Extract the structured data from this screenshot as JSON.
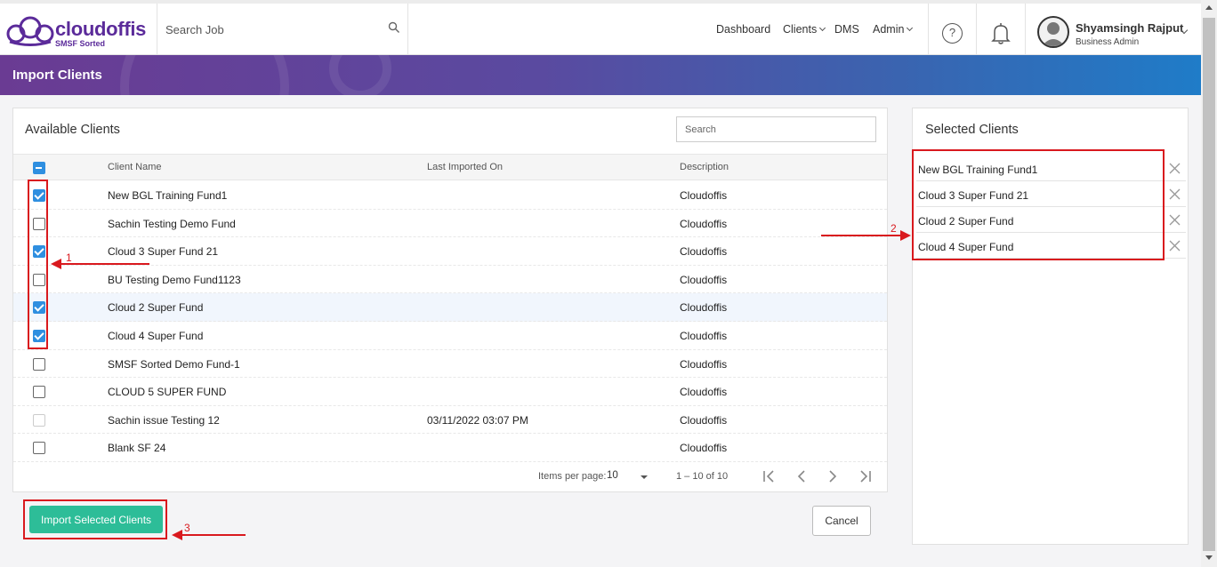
{
  "app": {
    "brand": "cloudoffis",
    "brand_sub": "SMSF Sorted",
    "search_placeholder": "Search Job"
  },
  "nav": {
    "dashboard": "Dashboard",
    "clients": "Clients",
    "dms": "DMS",
    "admin": "Admin"
  },
  "user": {
    "name": "Shyamsingh Rajput",
    "role": "Business Admin"
  },
  "page": {
    "title": "Import Clients"
  },
  "available": {
    "title": "Available Clients",
    "search_placeholder": "Search",
    "columns": [
      "Client Name",
      "Last Imported On",
      "Description"
    ],
    "rows": [
      {
        "name": "New BGL Training Fund1",
        "last_imported": "",
        "description": "Cloudoffis",
        "checked": true
      },
      {
        "name": "Sachin Testing Demo Fund",
        "last_imported": "",
        "description": "Cloudoffis",
        "checked": false
      },
      {
        "name": "Cloud 3 Super Fund 21",
        "last_imported": "",
        "description": "Cloudoffis",
        "checked": true
      },
      {
        "name": "BU Testing Demo Fund1123",
        "last_imported": "",
        "description": "Cloudoffis",
        "checked": false
      },
      {
        "name": "Cloud 2 Super Fund",
        "last_imported": "",
        "description": "Cloudoffis",
        "checked": true
      },
      {
        "name": "Cloud 4 Super Fund",
        "last_imported": "",
        "description": "Cloudoffis",
        "checked": true
      },
      {
        "name": "SMSF Sorted Demo Fund-1",
        "last_imported": "",
        "description": "Cloudoffis",
        "checked": false
      },
      {
        "name": "CLOUD 5 SUPER FUND",
        "last_imported": "",
        "description": "Cloudoffis",
        "checked": false
      },
      {
        "name": "Sachin issue Testing 12",
        "last_imported": "03/11/2022 03:07 PM",
        "description": "Cloudoffis",
        "checked": false,
        "disabled": true
      },
      {
        "name": "Blank SF 24",
        "last_imported": "",
        "description": "Cloudoffis",
        "checked": false
      }
    ],
    "items_per_page_label": "Items per page:",
    "items_per_page": "10",
    "range": "1 – 10 of 10"
  },
  "selected": {
    "title": "Selected Clients",
    "items": [
      "New BGL Training Fund1",
      "Cloud 3 Super Fund 21",
      "Cloud 2 Super Fund",
      "Cloud 4 Super Fund"
    ]
  },
  "actions": {
    "import": "Import Selected Clients",
    "cancel": "Cancel"
  },
  "annotations": [
    "1",
    "2",
    "3"
  ],
  "colors": {
    "brand_purple": "#5b2b9a",
    "import_button": "#2dbd98",
    "checkbox_blue": "#2f8fe0",
    "annotation_red": "#d9191e"
  }
}
